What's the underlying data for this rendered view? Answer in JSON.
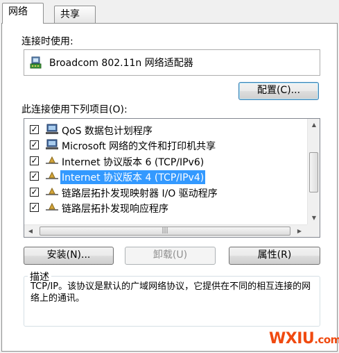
{
  "tabs": [
    {
      "label": "网络",
      "active": true
    },
    {
      "label": "共享",
      "active": false
    }
  ],
  "connect_using_label": "连接时使用:",
  "adapter_name": "Broadcom 802.11n 网络适配器",
  "configure_button": "配置(C)...",
  "items_label": "此连接使用下列项目(O):",
  "items": [
    {
      "label": "QoS 数据包计划程序",
      "checked": true,
      "icon": "service-icon",
      "selected": false
    },
    {
      "label": "Microsoft 网络的文件和打印机共享",
      "checked": true,
      "icon": "network-client-icon",
      "selected": false
    },
    {
      "label": "Internet 协议版本 6 (TCP/IPv6)",
      "checked": true,
      "icon": "protocol-icon",
      "selected": false
    },
    {
      "label": "Internet 协议版本 4 (TCP/IPv4)",
      "checked": true,
      "icon": "protocol-icon",
      "selected": true
    },
    {
      "label": "链路层拓扑发现映射器 I/O 驱动程序",
      "checked": true,
      "icon": "protocol-icon",
      "selected": false
    },
    {
      "label": "链路层拓扑发现响应程序",
      "checked": true,
      "icon": "protocol-icon",
      "selected": false
    }
  ],
  "install_button": "安装(N)...",
  "uninstall_button": "卸载(U)",
  "properties_button": "属性(R)",
  "description_label": "描述",
  "description_text": "TCP/IP。该协议是默认的广域网络协议，它提供在不同的相互连接的网络上的通讯。",
  "watermark": {
    "main": "WXIU",
    "suffix": ".com"
  },
  "colors": {
    "selection": "#3399ff",
    "watermark": "#f04a10"
  }
}
